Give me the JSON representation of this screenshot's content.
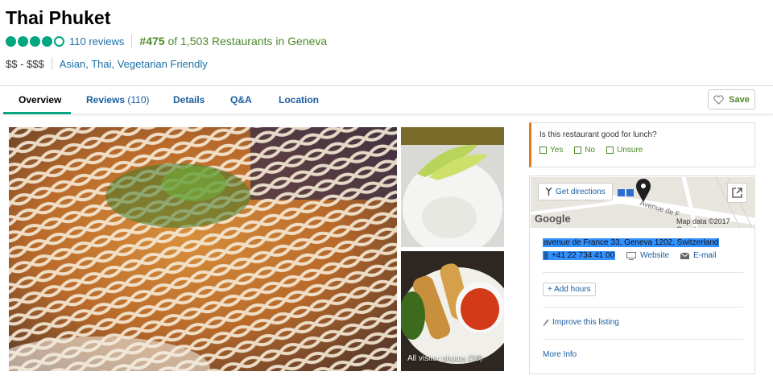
{
  "restaurant": {
    "name": "Thai Phuket",
    "reviews_link": "110 reviews",
    "rank_number": "#475",
    "rank_text": "of 1,503 Restaurants in Geneva",
    "price_range": "$$ - $$$",
    "cuisines": "Asian, Thai, Vegetarian Friendly",
    "rating_bubbles": 4.5
  },
  "tabs": [
    {
      "label": "Overview",
      "active": true
    },
    {
      "label": "Reviews",
      "count": "(110)"
    },
    {
      "label": "Details"
    },
    {
      "label": "Q&A"
    },
    {
      "label": "Location"
    }
  ],
  "save_label": "Save",
  "photos": {
    "all_label": "All visitor photos",
    "all_count": "(18)"
  },
  "lunch": {
    "question": "Is this restaurant good for lunch?",
    "options": [
      "Yes",
      "No",
      "Unsure"
    ]
  },
  "map": {
    "directions_label": "Get directions",
    "google_label": "Google",
    "map_data": "Map data ©2017 Google",
    "road_label": "Avenue de F"
  },
  "contact": {
    "address": "avenue de France 33, Geneva 1202, Switzerland",
    "phone": "+41 22 734 41 00",
    "website": "Website",
    "email": "E-mail"
  },
  "actions": {
    "add_hours": "+ Add hours",
    "improve": "Improve this listing",
    "more_info": "More Info"
  },
  "colors": {
    "brand_green": "#00a680",
    "link_blue": "#1a5ea0",
    "rank_green": "#4d8a2a",
    "lunch_accent": "#e07a1b"
  }
}
